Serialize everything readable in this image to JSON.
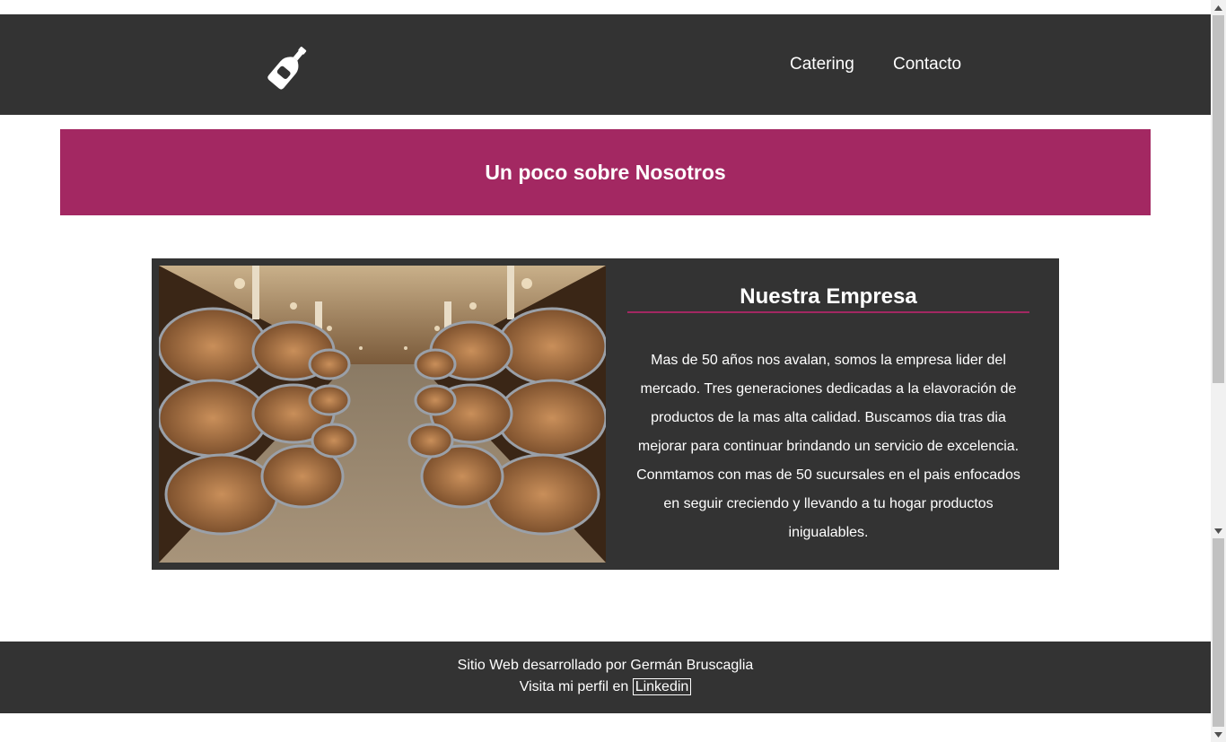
{
  "header": {
    "logo_icon": "wine-bottle-icon",
    "nav": [
      {
        "label": "Catering"
      },
      {
        "label": "Contacto"
      }
    ]
  },
  "banner": {
    "title": "Un poco sobre Nosotros",
    "color": "#a32862"
  },
  "about": {
    "image_icon": "wine-cellar-barrels-photo",
    "title": "Nuestra Empresa",
    "text": "Mas de 50 años nos avalan, somos la empresa lider del mercado. Tres generaciones dedicadas a la elavoración de productos de la mas alta calidad. Buscamos dia tras dia mejorar para continuar brindando un servicio de excelencia. Conmtamos con mas de 50 sucursales en el pais enfocados en seguir creciendo y llevando a tu hogar productos inigualables."
  },
  "footer": {
    "credit": "Sitio Web desarrollado por Germán Bruscaglia",
    "profile_prefix": "Visita mi perfil en ",
    "profile_link": "Linkedin"
  },
  "colors": {
    "dark": "#333333",
    "accent": "#a32862",
    "text": "#ffffff"
  }
}
